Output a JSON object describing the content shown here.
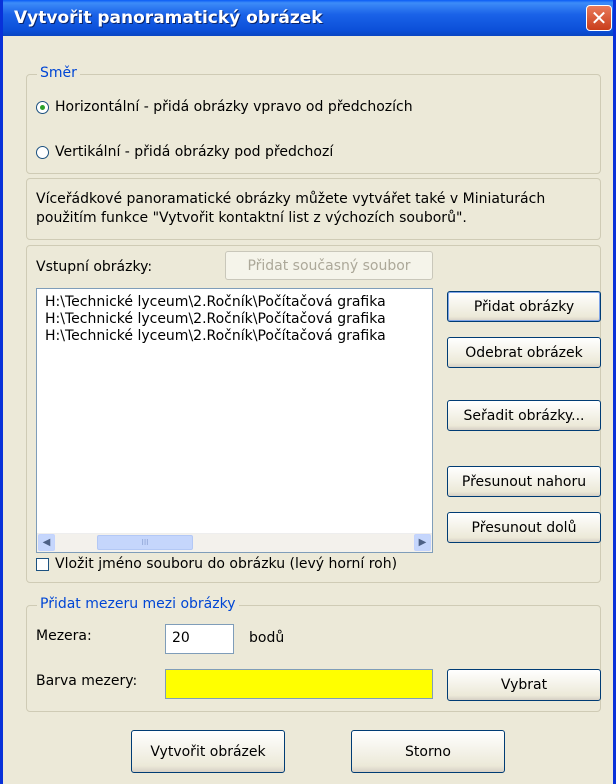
{
  "window": {
    "title": "Vytvořit panoramatický obrázek",
    "close_glyph": "✕"
  },
  "direction": {
    "group_label": "Směr",
    "horizontal_label": "Horizontální - přidá obrázky vpravo od předchozích",
    "vertical_label": "Vertikální - přidá obrázky pod předchozí",
    "selected": "horizontal"
  },
  "info": {
    "line1": "Víceřádkové panoramatické obrázky můžete vytvářet také v Miniaturách",
    "line2": "použitím funkce \"Vytvořit kontaktní list z výchozích souborů\"."
  },
  "inputs": {
    "label": "Vstupní obrázky:",
    "add_current_button": "Přidat současný soubor",
    "files": [
      "H:\\Technické lyceum\\2.Ročník\\Počítačová grafika",
      "H:\\Technické lyceum\\2.Ročník\\Počítačová grafika",
      "H:\\Technické lyceum\\2.Ročník\\Počítačová grafika"
    ],
    "scroll_left": "◀",
    "scroll_right": "▶",
    "thumb_grip": "III"
  },
  "side_buttons": {
    "add": "Přidat obrázky",
    "remove": "Odebrat obrázek",
    "sort": "Seřadit obrázky...",
    "move_up": "Přesunout nahoru",
    "move_down": "Přesunout dolů"
  },
  "insert_filename": {
    "label": "Vložit jméno souboru do obrázku (levý horní roh)",
    "checked": false
  },
  "gap": {
    "group_label": "Přidat mezeru mezi obrázky",
    "gap_label": "Mezera:",
    "gap_value": "20",
    "gap_unit": "bodů",
    "color_label": "Barva mezery:",
    "color": "#ffff00",
    "choose_button": "Vybrat"
  },
  "footer": {
    "create_button": "Vytvořit obrázek",
    "cancel_button": "Storno"
  }
}
